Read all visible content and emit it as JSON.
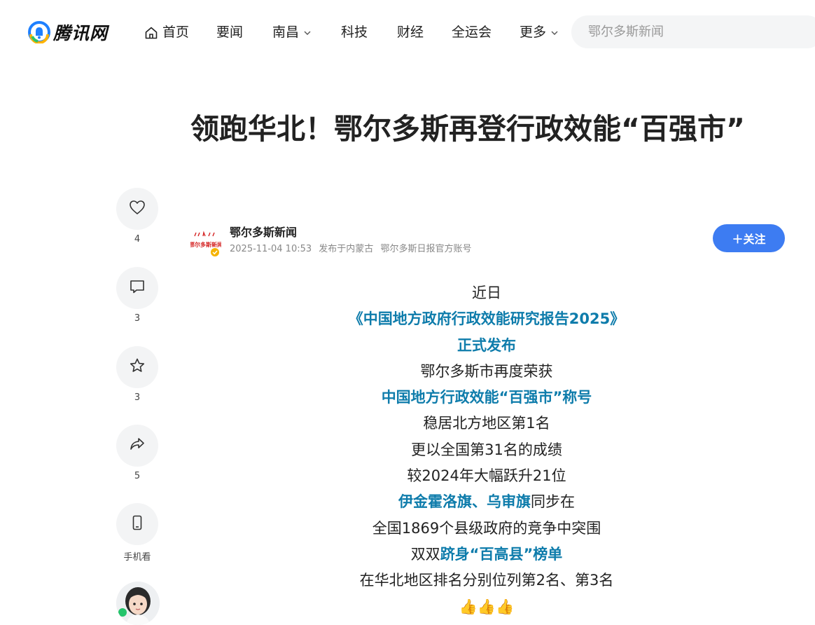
{
  "header": {
    "logo_text": "腾讯网",
    "nav": [
      {
        "label": "首页",
        "icon": "home-icon"
      },
      {
        "label": "要闻"
      },
      {
        "label": "南昌",
        "dropdown": true
      },
      {
        "label": "科技"
      },
      {
        "label": "财经"
      },
      {
        "label": "全运会"
      },
      {
        "label": "更多",
        "dropdown": true
      }
    ],
    "search_placeholder": "鄂尔多斯新闻"
  },
  "sidebar": {
    "like_count": "4",
    "comment_count": "3",
    "favorite_count": "3",
    "share_count": "5",
    "mobile_label": "手机看"
  },
  "article": {
    "title": "领跑华北！鄂尔多斯再登行政效能“百强市”",
    "author": {
      "name": "鄂尔多斯新闻",
      "datetime": "2025-11-04 10:53",
      "location": "发布于内蒙古",
      "account_desc": "鄂尔多斯日报官方账号",
      "avatar_text": "鄂尔多斯新闻",
      "follow_label": "＋关注"
    },
    "lines": [
      {
        "parts": [
          {
            "text": "近日",
            "hl": false
          }
        ]
      },
      {
        "parts": [
          {
            "text": "《中国地方政府行政效能研究报告2025》",
            "hl": true
          }
        ]
      },
      {
        "parts": [
          {
            "text": "正式发布",
            "hl": true
          }
        ]
      },
      {
        "parts": [
          {
            "text": "鄂尔多斯市再度荣获",
            "hl": false
          }
        ]
      },
      {
        "parts": [
          {
            "text": "中国地方行政效能“百强市”称号",
            "hl": true
          }
        ]
      },
      {
        "parts": [
          {
            "text": "稳居北方地区第1名",
            "hl": false
          }
        ]
      },
      {
        "parts": [
          {
            "text": "更以全国第31名的成绩",
            "hl": false
          }
        ]
      },
      {
        "parts": [
          {
            "text": "较2024年大幅跃升21位",
            "hl": false
          }
        ]
      },
      {
        "parts": [
          {
            "text": "伊金霍洛旗、乌审旗",
            "hl": true
          },
          {
            "text": "同步在",
            "hl": false
          }
        ]
      },
      {
        "parts": [
          {
            "text": "全国1869个县级政府的竞争中突围",
            "hl": false
          }
        ]
      },
      {
        "parts": [
          {
            "text": "双双",
            "hl": false
          },
          {
            "text": "跻身“百高县”榜单",
            "hl": true
          }
        ]
      },
      {
        "parts": [
          {
            "text": "在华北地区排名分别位列第2名、第3名",
            "hl": false
          }
        ]
      },
      {
        "parts": [
          {
            "text": "👍👍👍",
            "hl": false
          }
        ]
      }
    ]
  },
  "colors": {
    "accent_blue": "#3d7cf2",
    "highlight_text": "#0e7cab",
    "sidebar_bg": "#f3f4f5"
  }
}
